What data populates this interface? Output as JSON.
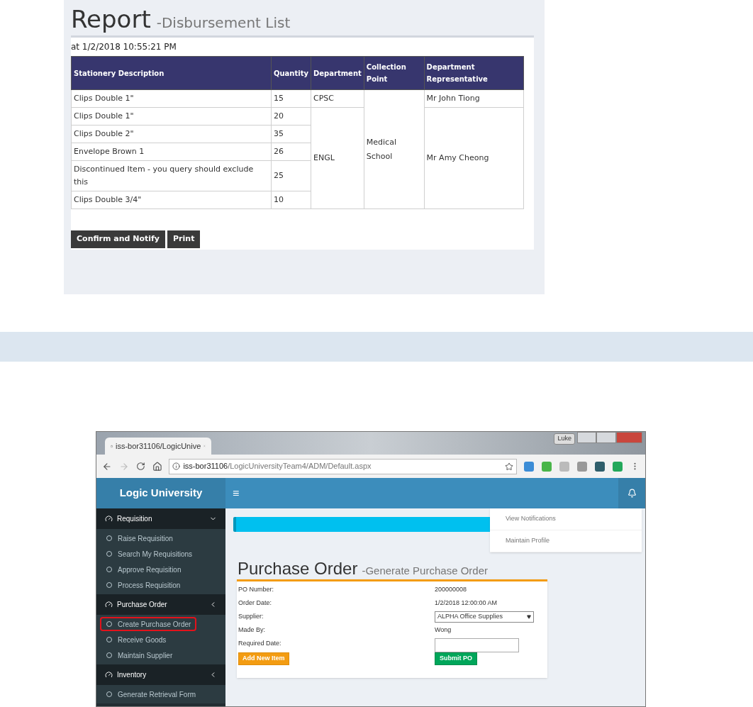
{
  "report": {
    "title": "Report",
    "subtitle": "-Disbursement List",
    "timestamp": "at 1/2/2018 10:55:21 PM",
    "columns": [
      "Stationery Description",
      "Quantity",
      "Department",
      "Collection Point",
      "Department Representative"
    ],
    "collection_points": [
      {
        "name": "Medical School",
        "departments": [
          {
            "name": "CPSC",
            "representative": "Mr John Tiong",
            "items": [
              {
                "description": "Clips Double 1\"",
                "quantity": "15"
              }
            ]
          },
          {
            "name": "ENGL",
            "representative": "Mr Amy Cheong",
            "items": [
              {
                "description": "Clips Double 1\"",
                "quantity": "20"
              },
              {
                "description": "Clips Double 2\"",
                "quantity": "35"
              },
              {
                "description": "Envelope Brown 1",
                "quantity": "26"
              },
              {
                "description": "Discontinued Item - you query should exclude this",
                "quantity": "25"
              },
              {
                "description": "Clips Double 3/4\"",
                "quantity": "10"
              }
            ]
          }
        ]
      }
    ],
    "buttons": [
      "Confirm and Notify",
      "Print"
    ]
  },
  "browser": {
    "tab_title": "iss-bor31106/LogicUnive",
    "user": "Luke",
    "url_host": "iss-bor31106",
    "url_path": "/LogicUniversityTeam4/ADM/Default.aspx",
    "app": {
      "brand": "Logic University",
      "menu_icon": "≡",
      "sidebar": [
        {
          "label": "Requisition",
          "expanded": true,
          "items": [
            {
              "label": "Raise Requisition",
              "highlighted": false
            },
            {
              "label": "Search My Requisitions",
              "highlighted": false
            },
            {
              "label": "Approve Requisition",
              "highlighted": false
            },
            {
              "label": "Process Requisition",
              "highlighted": false
            }
          ]
        },
        {
          "label": "Purchase Order",
          "expanded": false,
          "items": [
            {
              "label": "Create Purchase Order",
              "highlighted": true
            },
            {
              "label": "Receive Goods",
              "highlighted": false
            },
            {
              "label": "Maintain Supplier",
              "highlighted": false
            }
          ]
        },
        {
          "label": "Inventory",
          "expanded": false,
          "items": [
            {
              "label": "Generate Retrieval Form",
              "highlighted": false
            }
          ]
        }
      ],
      "user_menu": [
        "View Notifications",
        "Maintain Profile"
      ],
      "page_title": "Purchase Order",
      "page_subtitle": "-Generate Purchase Order",
      "form": [
        {
          "label": "PO Number:",
          "kind": "text",
          "value": "200000008"
        },
        {
          "label": "Order Date:",
          "kind": "text",
          "value": "1/2/2018 12:00:00 AM"
        },
        {
          "label": "Supplier:",
          "kind": "select",
          "value": "ALPHA Office Supplies"
        },
        {
          "label": "Made By:",
          "kind": "text",
          "value": "Wong"
        },
        {
          "label": "Required Date:",
          "kind": "input"
        }
      ],
      "add_button": "Add New Item",
      "submit_button": "Submit PO"
    }
  }
}
